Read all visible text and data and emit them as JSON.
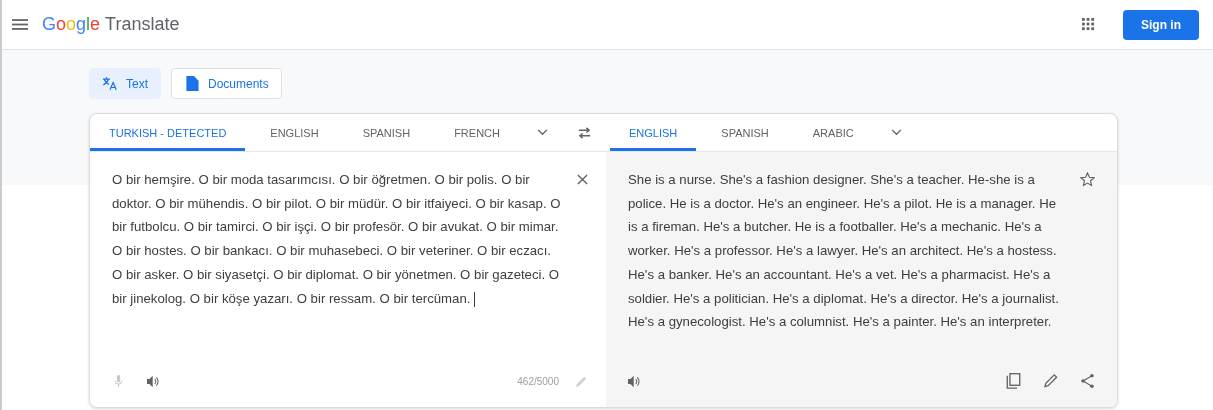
{
  "header": {
    "logo": "Google",
    "product": "Translate",
    "sign_in": "Sign in"
  },
  "modes": [
    {
      "label": "Text",
      "kind": "text",
      "selected": true
    },
    {
      "label": "Documents",
      "kind": "document",
      "selected": false
    }
  ],
  "source_tabs": [
    {
      "label": "TURKISH - DETECTED",
      "selected": true
    },
    {
      "label": "ENGLISH",
      "selected": false
    },
    {
      "label": "SPANISH",
      "selected": false
    },
    {
      "label": "FRENCH",
      "selected": false
    }
  ],
  "target_tabs": [
    {
      "label": "ENGLISH",
      "selected": true
    },
    {
      "label": "SPANISH",
      "selected": false
    },
    {
      "label": "ARABIC",
      "selected": false
    }
  ],
  "source": {
    "value": "O bir hemşire. O bir moda tasarımcısı. O bir öğretmen. O bir polis. O bir doktor. O bir mühendis. O bir pilot. O bir müdür. O bir itfaiyeci. O bir kasap. O bir futbolcu. O bir tamirci. O bir işçi. O bir profesör. O bir avukat. O bir mimar. O bir hostes. O bir bankacı. O bir muhasebeci. O bir veteriner. O bir eczacı. O bir asker. O bir siyasetçi. O bir diplomat. O bir yönetmen. O bir gazeteci. O bir jinekolog. O bir köşe yazarı. O bir ressam. O bir tercüman. ",
    "count": "462/5000"
  },
  "translation": {
    "text": "She is a nurse. She's a fashion designer. She's a teacher. He-she is a police. He is a doctor. He's an engineer. He's a pilot. He is a manager. He is a fireman. He's a butcher. He is a footballer. He's a mechanic. He's a worker. He's a professor. He's a lawyer. He's an architect. He's a hostess. He's a banker. He's an accountant. He's a vet. He's a pharmacist. He's a soldier. He's a politician. He's a diplomat. He's a director. He's a journalist. He's a gynecologist. He's a columnist. He's a painter. He's an interpreter."
  }
}
